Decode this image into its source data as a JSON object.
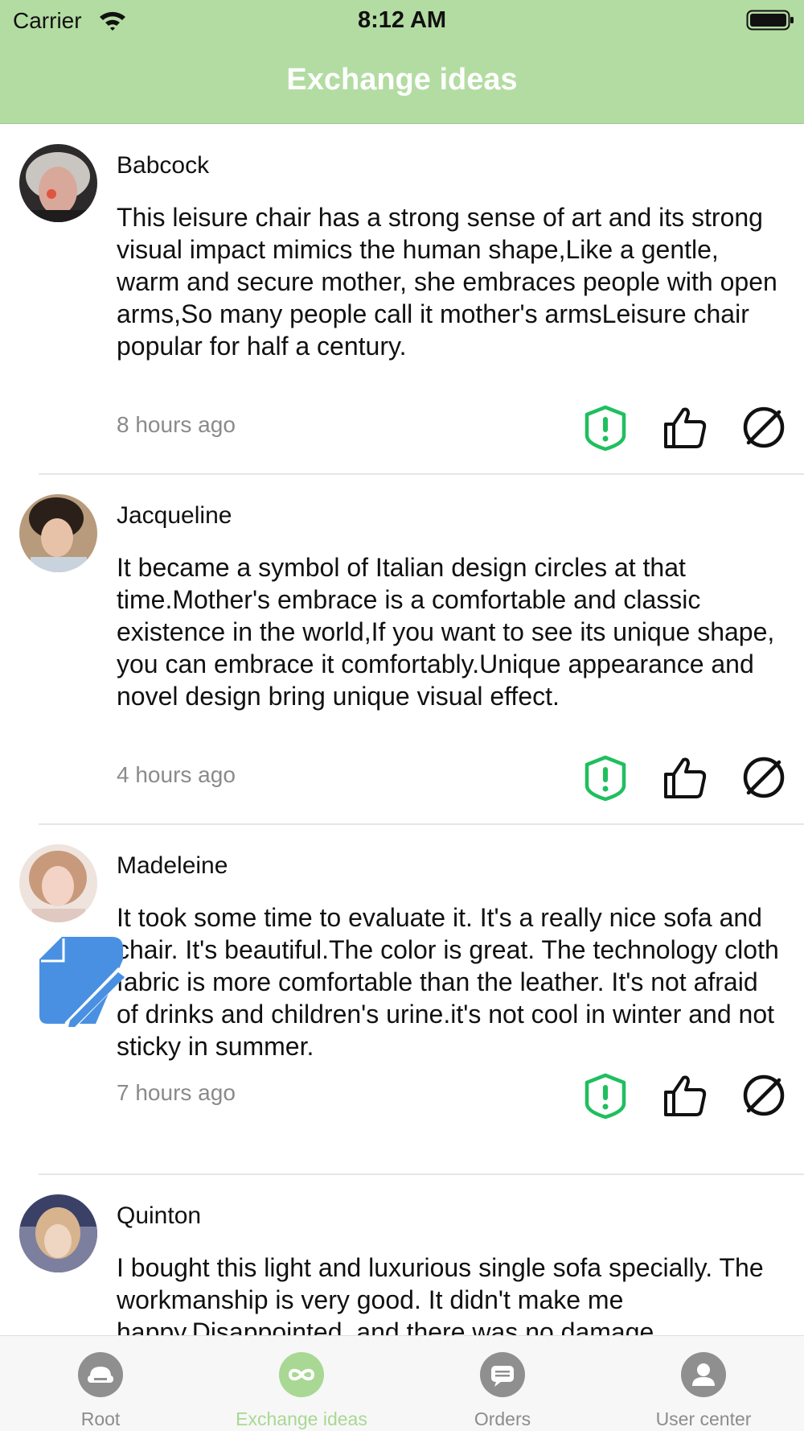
{
  "status_bar": {
    "carrier": "Carrier",
    "time": "8:12 AM"
  },
  "nav": {
    "title": "Exchange ideas"
  },
  "posts": [
    {
      "username": "Babcock",
      "content": "This leisure chair has a strong sense of art and its strong visual impact mimics the human shape,Like a gentle, warm and secure mother, she embraces people with open arms,So many people call it mother's armsLeisure chair popular for half a century.",
      "time": "8 hours ago"
    },
    {
      "username": "Jacqueline",
      "content": "It became a symbol of Italian design circles at that time.Mother's embrace is a comfortable and classic existence in the world,If you want to see its unique shape, you can embrace it comfortably.Unique appearance and novel design bring unique visual effect.",
      "time": "4 hours ago"
    },
    {
      "username": "Madeleine",
      "content": "It took some time to evaluate it. It's a really nice sofa and chair. It's beautiful.The color is great. The technology cloth fabric is more comfortable than the leather. It's not afraid of drinks and children's urine.it's not cool in winter and not sticky in summer.",
      "time": "7 hours ago"
    },
    {
      "username": "Quinton",
      "content": "I bought this light and luxurious single sofa specially. The workmanship is very good. It didn't make me happy.Disappointed, and there was no damage."
    }
  ],
  "icons": {
    "report": "shield-alert-icon",
    "like": "thumbs-up-icon",
    "block": "block-icon",
    "compose": "compose-icon"
  },
  "tabs": [
    {
      "label": "Root",
      "icon": "sofa-icon"
    },
    {
      "label": "Exchange ideas",
      "icon": "infinity-icon",
      "active": true
    },
    {
      "label": "Orders",
      "icon": "message-icon"
    },
    {
      "label": "User center",
      "icon": "person-icon"
    }
  ],
  "colors": {
    "nav_bar": "#b3dca2",
    "report_icon": "#1fbf5e",
    "active_tab": "#a8d893",
    "compose_button": "#4a90e2"
  }
}
